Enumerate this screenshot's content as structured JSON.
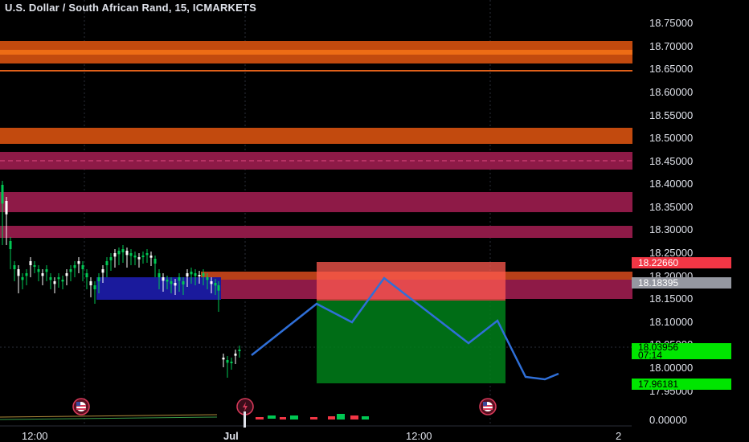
{
  "header": {
    "title": "U.S. Dollar / South African Rand, 15, ICMARKETS"
  },
  "price_axis": {
    "ticks": [
      "18.75000",
      "18.70000",
      "18.65000",
      "18.60000",
      "18.55000",
      "18.50000",
      "18.45000",
      "18.40000",
      "18.35000",
      "18.30000",
      "18.25000",
      "18.20000",
      "18.15000",
      "18.10000",
      "18.05000",
      "18.00000",
      "17.95000"
    ],
    "indicator_zero": "0.00000"
  },
  "price_tags": {
    "red": {
      "value": "18.22660",
      "color": "#f23645"
    },
    "gray": {
      "value": "18.18395",
      "color": "#9598a1"
    },
    "current": {
      "value": "18.03956",
      "countdown": "07:14",
      "color": "#00e600"
    },
    "target": {
      "value": "17.96181",
      "color": "#00e600"
    }
  },
  "time_axis": {
    "labels": [
      "12:00",
      "Jul",
      "12:00",
      "2"
    ]
  },
  "zones": [
    {
      "kind": "supply",
      "color": "#ff6a00"
    },
    {
      "kind": "supply",
      "color": "#ff6a00"
    },
    {
      "kind": "supply",
      "color": "#a01e50"
    },
    {
      "kind": "supply",
      "color": "#a01e50"
    },
    {
      "kind": "supply",
      "color": "#a01e50"
    },
    {
      "kind": "demand",
      "color": "#1a1a9c"
    }
  ],
  "position": {
    "type": "short",
    "risk_color": "#ff5a4f",
    "reward_color": "#00a020"
  },
  "projection": {
    "color": "#2f6fd8"
  },
  "events": [
    {
      "icon": "us-flag-icon"
    },
    {
      "icon": "us-flag-icon"
    },
    {
      "icon": "lightning-icon"
    }
  ],
  "candle_colors": {
    "up": "#00c853",
    "down": "#ffffff"
  }
}
